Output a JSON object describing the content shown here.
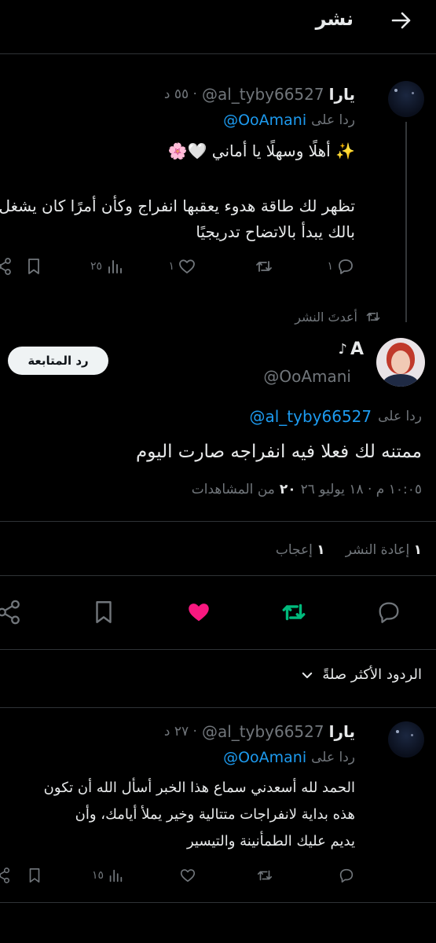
{
  "header": {
    "title": "نشر"
  },
  "tweet1": {
    "name": "يارا",
    "handle": "@al_tyby66527",
    "time": "· ٥٥ د",
    "reply_prefix": "ردا على",
    "reply_to": "@OoAmani",
    "line1": "✨ أهلًا وسهلًا يا أماني 🤍🌸",
    "line2": "تظهر لك طاقة هدوء يعقبها انفراج وكأن أمرًا كان يشغل",
    "line3": "بالك يبدأ بالاتضاح تدريجيًا",
    "replies": "١",
    "retweets": "",
    "likes": "١",
    "views": "٢٥"
  },
  "main": {
    "reposted_label": "أعدتَ النشر",
    "name": "A",
    "name_suffix": "♪",
    "handle": "@OoAmani",
    "follow_button": "رد المتابعة",
    "reply_prefix": "ردا على",
    "reply_to": "@al_tyby66527",
    "text": "ممتنه لك فعلا فيه انفراجه صارت اليوم",
    "timestamp": "١٠:٠٥ م · ١٨ يوليو ٢٦",
    "views_count": "٢٠",
    "views_label": "من المشاهدات",
    "reposts_count": "١",
    "reposts_label": "إعادة النشر",
    "likes_count": "١",
    "likes_label": "إعجاب"
  },
  "sort": {
    "label": "الردود الأكثر صلةً"
  },
  "tweet2": {
    "name": "يارا",
    "handle": "@al_tyby66527",
    "time": "· ٢٧ د",
    "reply_prefix": "ردا على",
    "reply_to": "@OoAmani",
    "line1": "الحمد لله أسعدني سماع هذا الخبر أسأل الله أن تكون",
    "line2": "هذه بداية لانفراجات متتالية وخير يملأ أيامك، وأن",
    "line3": "يديم عليك الطمأنينة والتيسير",
    "replies": "",
    "retweets": "",
    "likes": "",
    "views": "١٥"
  },
  "colors": {
    "like": "#f91880",
    "retweet": "#00ba7c",
    "link": "#1d9bf0",
    "muted": "#71767b"
  }
}
